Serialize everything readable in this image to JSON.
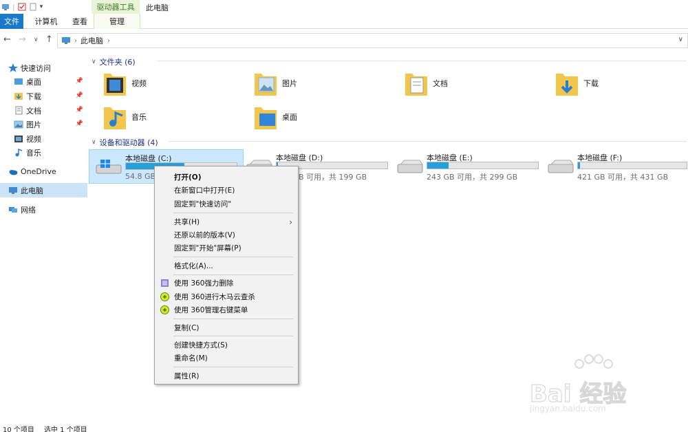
{
  "ribbon": {
    "context_group": "驱动器工具",
    "window_title": "此电脑",
    "tabs": [
      "文件",
      "计算机",
      "查看",
      "管理"
    ]
  },
  "address": {
    "path": [
      "此电脑"
    ]
  },
  "sidebar": {
    "items": [
      {
        "label": "快速访问",
        "icon": "star-icon"
      },
      {
        "label": "桌面",
        "icon": "desktop-folder-icon",
        "pinned": true
      },
      {
        "label": "下载",
        "icon": "download-folder-icon",
        "pinned": true
      },
      {
        "label": "文档",
        "icon": "documents-folder-icon",
        "pinned": true
      },
      {
        "label": "图片",
        "icon": "pictures-folder-icon",
        "pinned": true
      },
      {
        "label": "视频",
        "icon": "videos-folder-icon"
      },
      {
        "label": "音乐",
        "icon": "music-folder-icon"
      },
      {
        "label": "OneDrive",
        "icon": "onedrive-cloud-icon"
      },
      {
        "label": "此电脑",
        "icon": "this-pc-icon",
        "selected": true
      },
      {
        "label": "网络",
        "icon": "network-icon"
      }
    ]
  },
  "folders_section": {
    "title": "文件夹 (6)",
    "items": [
      {
        "label": "视频",
        "icon": "videos-folder-icon"
      },
      {
        "label": "图片",
        "icon": "pictures-folder-icon"
      },
      {
        "label": "文档",
        "icon": "documents-folder-icon"
      },
      {
        "label": "下载",
        "icon": "download-folder-icon"
      },
      {
        "label": "音乐",
        "icon": "music-folder-icon"
      },
      {
        "label": "桌面",
        "icon": "desktop-folder-icon"
      }
    ]
  },
  "drives_section": {
    "title": "设备和驱动器 (4)",
    "items": [
      {
        "name": "本地磁盘 (C:)",
        "free": "54.8 GB",
        "used_fraction": 0.53,
        "selected": true
      },
      {
        "name": "本地磁盘 (D:)",
        "free": "198 GB 可用，共 199 GB",
        "used_fraction": 0.01
      },
      {
        "name": "本地磁盘 (E:)",
        "free": "243 GB 可用，共 299 GB",
        "used_fraction": 0.19
      },
      {
        "name": "本地磁盘 (F:)",
        "free": "421 GB 可用，共 431 GB",
        "used_fraction": 0.02
      }
    ]
  },
  "context_menu": {
    "items": [
      {
        "label": "打开(O)",
        "bold": true
      },
      {
        "label": "在新窗口中打开(E)"
      },
      {
        "label": "固定到\"快速访问\""
      },
      {
        "label": "共享(H)",
        "submenu": true
      },
      {
        "label": "还原以前的版本(V)"
      },
      {
        "label": "固定到\"开始\"屏幕(P)"
      },
      {
        "label": "格式化(A)..."
      },
      {
        "label": "使用 360强力删除",
        "icon": "360-shred-icon"
      },
      {
        "label": "使用 360进行木马云查杀",
        "icon": "360-antivirus-icon"
      },
      {
        "label": "使用 360管理右键菜单",
        "icon": "360-manager-icon"
      },
      {
        "label": "复制(C)"
      },
      {
        "label": "创建快捷方式(S)"
      },
      {
        "label": "重命名(M)"
      },
      {
        "label": "属性(R)"
      }
    ]
  },
  "status": {
    "count": "10 个项目",
    "selected": "选中 1 个项目"
  },
  "watermark": {
    "brand": "Bai 经验",
    "url": "jingyan.baidu.com"
  },
  "colors": {
    "accent": "#1979ca",
    "selection": "#cce8ff",
    "drive_fill": "#26a0da",
    "ribbon_context": "#e8f3d8"
  }
}
